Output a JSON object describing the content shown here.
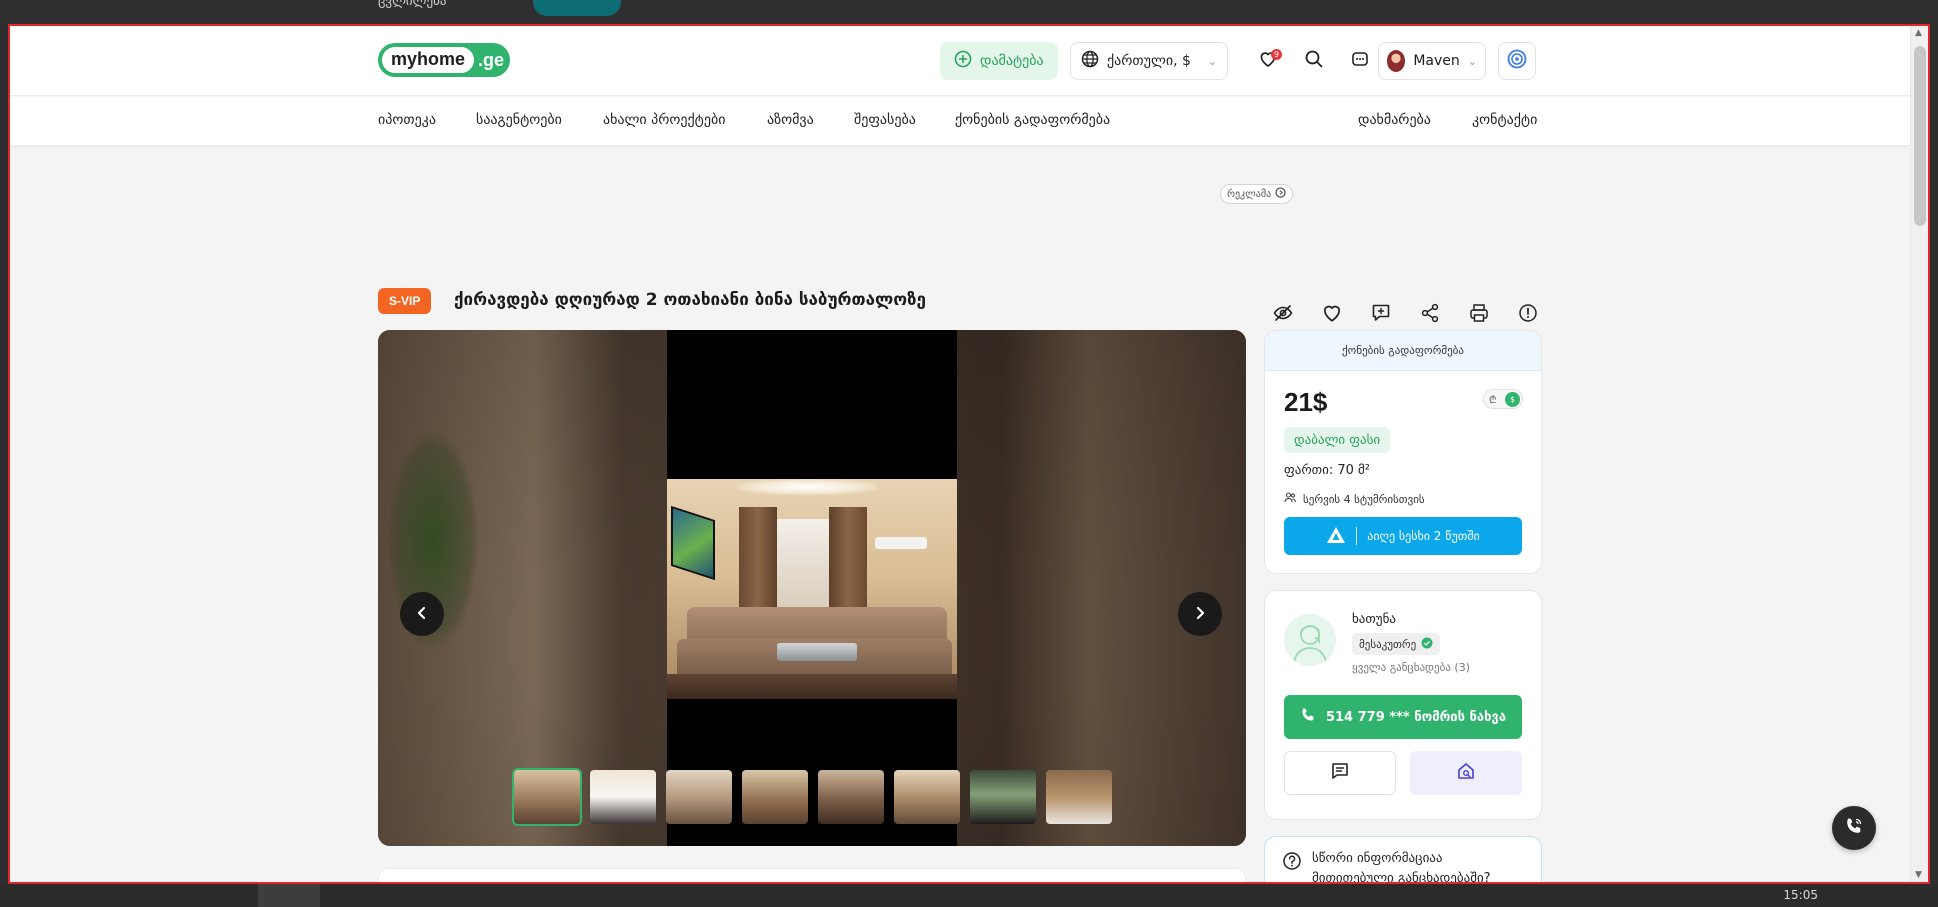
{
  "os": {
    "top_ghost_text": "ცვლილება",
    "clock": "15:05"
  },
  "header": {
    "logo_main": "myhome",
    "logo_tld": ".ge",
    "add_label": "დამატება",
    "language_label": "ქართული, $",
    "favorites_count": "9",
    "user_name": "Maven"
  },
  "nav": {
    "items": [
      "იპოთეკა",
      "სააგენტოები",
      "ახალი პროექტები",
      "აზომვა",
      "შეფასება",
      "ქონების გადაფორმება"
    ],
    "right_items": [
      "დახმარება",
      "კონტაქტი"
    ]
  },
  "ad": {
    "label": "რეკლამა"
  },
  "listing": {
    "badge": "S-VIP",
    "title": "ქირავდება დღიურად 2 ოთახიანი ბინა საბურთალოზე"
  },
  "price_card": {
    "header": "ქონების გადაფორმება",
    "price": "21$",
    "currency_gel": "₾",
    "currency_usd": "$",
    "low_price_badge": "დაბალი ფასი",
    "area": "ფართი: 70 მ²",
    "service": "სერვის 4 სტუმრისთვის",
    "app_button": "აიღე სესხი 2 წუთში"
  },
  "agent": {
    "name": "ხათუნა",
    "role": "მესაკუთრე",
    "all_listings": "ყველა განცხადება (3)",
    "phone": "514 779 ***  ნომრის ნახვა"
  },
  "info_card": {
    "line1": "სწორი ინფორმაციაა",
    "line2": "მითითებული განცხადებაში?"
  },
  "colors": {
    "brand_green": "#2fb36d",
    "svip_orange": "#f26522",
    "app_blue": "#0aa7eb",
    "frame_red": "#e3262d"
  },
  "icons": [
    "add-circle-icon",
    "globe-icon",
    "heart-icon",
    "search-icon",
    "chat-icon",
    "swirl-icon",
    "hide-icon",
    "comment-icon",
    "share-icon",
    "print-icon",
    "info-icon",
    "chevron-left-icon",
    "chevron-right-icon",
    "phone-icon",
    "message-icon",
    "home-search-icon",
    "question-icon"
  ]
}
